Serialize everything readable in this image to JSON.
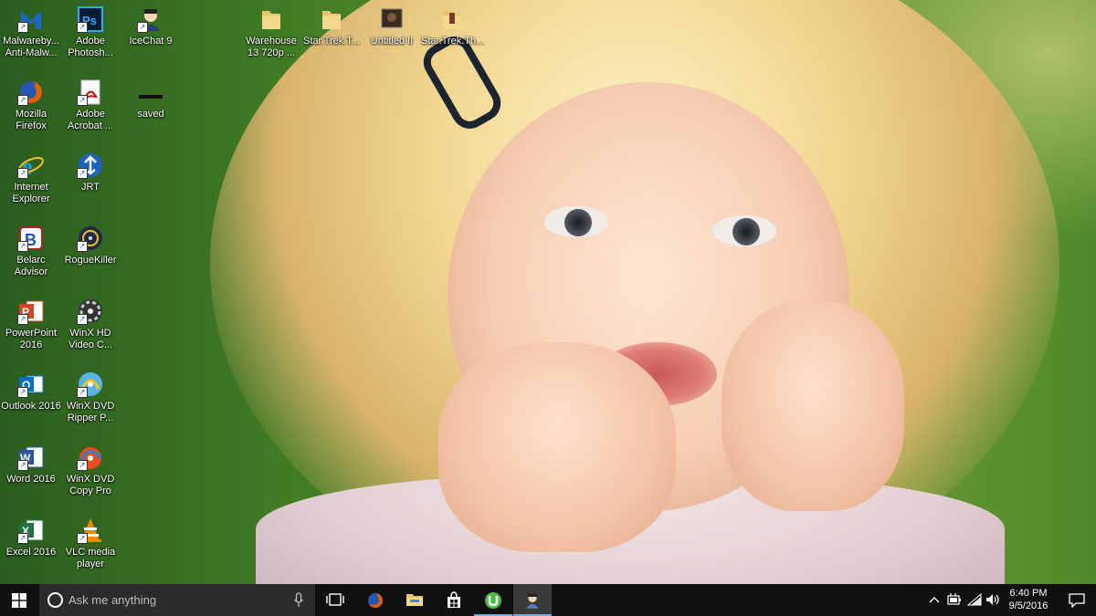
{
  "desktop": {
    "icons": [
      {
        "label": "Malwareby...\nAnti-Malw...",
        "icon": "malwarebytes-icon"
      },
      {
        "label": "Adobe Photosh...",
        "icon": "photoshop-icon"
      },
      {
        "label": "IceChat 9",
        "icon": "icechat-icon"
      },
      {
        "label": "Warehouse 13 720p ...",
        "icon": "folder-icon"
      },
      {
        "label": "Star.Trek.T...",
        "icon": "folder-icon"
      },
      {
        "label": "Untitled II",
        "icon": "video-thumbnail-icon"
      },
      {
        "label": "Star.Trek.Th...",
        "icon": "folder-icon"
      },
      {
        "label": "Mozilla Firefox",
        "icon": "firefox-icon"
      },
      {
        "label": "Adobe Acrobat ...",
        "icon": "acrobat-icon"
      },
      {
        "label": "saved",
        "icon": "text-file-icon"
      },
      {
        "label": "Internet Explorer",
        "icon": "internet-explorer-icon"
      },
      {
        "label": "JRT",
        "icon": "jrt-icon"
      },
      {
        "label": "Belarc Advisor",
        "icon": "belarc-icon"
      },
      {
        "label": "RogueKiller",
        "icon": "roguekiller-icon"
      },
      {
        "label": "PowerPoint 2016",
        "icon": "powerpoint-icon"
      },
      {
        "label": "WinX HD Video C...",
        "icon": "winx-hd-icon"
      },
      {
        "label": "Outlook 2016",
        "icon": "outlook-icon"
      },
      {
        "label": "WinX DVD Ripper P...",
        "icon": "winx-dvd-ripper-icon"
      },
      {
        "label": "Word 2016",
        "icon": "word-icon"
      },
      {
        "label": "WinX DVD Copy Pro",
        "icon": "winx-dvd-copy-icon"
      },
      {
        "label": "Excel 2016",
        "icon": "excel-icon"
      },
      {
        "label": "VLC media player",
        "icon": "vlc-icon"
      }
    ]
  },
  "taskbar": {
    "search_placeholder": "Ask me anything",
    "clock_time": "6:40 PM",
    "clock_date": "9/5/2016",
    "pinned": [
      "task-view-icon",
      "firefox-icon",
      "file-explorer-icon",
      "store-icon",
      "utorrent-icon",
      "icechat-icon"
    ],
    "colors": {
      "taskbar": "#101010",
      "search": "#2b2b2b",
      "active_indicator": "#7aa7d9"
    }
  }
}
